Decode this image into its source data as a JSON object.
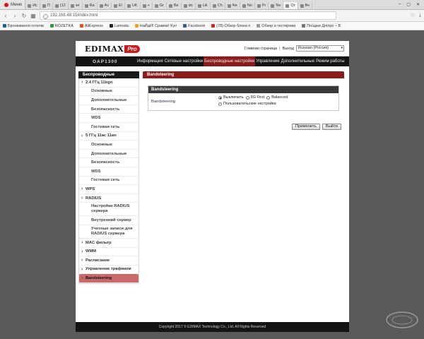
{
  "browser": {
    "menu_label": "Меню",
    "tabs": [
      "Ис",
      "П",
      "(12",
      "wr",
      "Ra",
      "Av",
      "El",
      "UK",
      "+",
      "Gr",
      "Be",
      "do",
      "Lik",
      "Ch",
      "Ne",
      "No",
      "Pr",
      "Ne",
      "Or",
      "Be"
    ],
    "active_tab_index": 18,
    "url": "192.168.48.15/index.html",
    "bookmarks": [
      {
        "label": "Бронювання готелів",
        "color": "#1e5ca8"
      },
      {
        "label": "ROZETKA",
        "color": "#2e9a3a"
      },
      {
        "label": "AliExpress",
        "color": "#e2531c"
      },
      {
        "label": "Lamoda",
        "color": "#222222"
      },
      {
        "label": "НаЙдИ! Сравни! Куп",
        "color": "#f0a020"
      },
      {
        "label": "Facebook",
        "color": "#3b5998"
      },
      {
        "label": "(78) Обзор блока п",
        "color": "#cc2222"
      },
      {
        "label": "Обзор и тестирова",
        "color": "#999999"
      },
      {
        "label": "Поїздки Дніпро – Б",
        "color": "#777777"
      }
    ]
  },
  "router": {
    "brand": "EDIMAX",
    "brand_suffix": "Pro",
    "model": "OAP1300",
    "top_links": {
      "home": "Главная страница",
      "exit": "Выход",
      "separator": "|"
    },
    "language": "Russian (Россия)",
    "nav": [
      "Информация",
      "Сетевые настройки",
      "Беспроводные настройки",
      "Управление",
      "Дополнительные",
      "Режим работы"
    ],
    "nav_active_index": 2,
    "sidebar": {
      "title": "Беспроводные",
      "items": [
        {
          "label": "2.4 ГГц 11bgn",
          "type": "grp"
        },
        {
          "label": "Основные",
          "type": "sub"
        },
        {
          "label": "Дополнительные",
          "type": "sub"
        },
        {
          "label": "Безопасность",
          "type": "sub"
        },
        {
          "label": "WDS",
          "type": "sub"
        },
        {
          "label": "Гостевая сеть",
          "type": "sub"
        },
        {
          "label": "5 ГГц 11ac 11an",
          "type": "grp"
        },
        {
          "label": "Основные",
          "type": "sub"
        },
        {
          "label": "Дополнительные",
          "type": "sub"
        },
        {
          "label": "Безопасность",
          "type": "sub"
        },
        {
          "label": "WDS",
          "type": "sub"
        },
        {
          "label": "Гостевая сеть",
          "type": "sub"
        },
        {
          "label": "WPS",
          "type": "grp"
        },
        {
          "label": "RADIUS",
          "type": "grp"
        },
        {
          "label": "Настройки RADIUS сервера",
          "type": "sub2"
        },
        {
          "label": "Внутренний сервер",
          "type": "sub"
        },
        {
          "label": "Учетные записи для RADIUS сервера",
          "type": "sub2"
        },
        {
          "label": "MAC фильтр",
          "type": "grp"
        },
        {
          "label": "WMM",
          "type": "grp"
        },
        {
          "label": "Расписание",
          "type": "grp"
        },
        {
          "label": "Управление трафиком",
          "type": "grp"
        },
        {
          "label": "Bandsteering",
          "type": "grp",
          "active": true
        }
      ]
    },
    "main": {
      "header": "Bandsteering",
      "card_title": "Bandsteering",
      "field_label": "Bandsteering",
      "options": [
        "Выключить",
        "5G First",
        "Balanced",
        "Пользовательские настройки"
      ],
      "selected_option": 0,
      "apply_label": "Применить",
      "exit_label": "Выйти"
    },
    "footer": "Copyright 2017 © EDIMAX Technology Co., Ltd. All Rights Reserved"
  },
  "watermark": "GECID.com",
  "colors": {
    "accent_red": "#8a1c1c",
    "brand_red": "#cc1a1a",
    "active_item": "#c96a6a"
  }
}
